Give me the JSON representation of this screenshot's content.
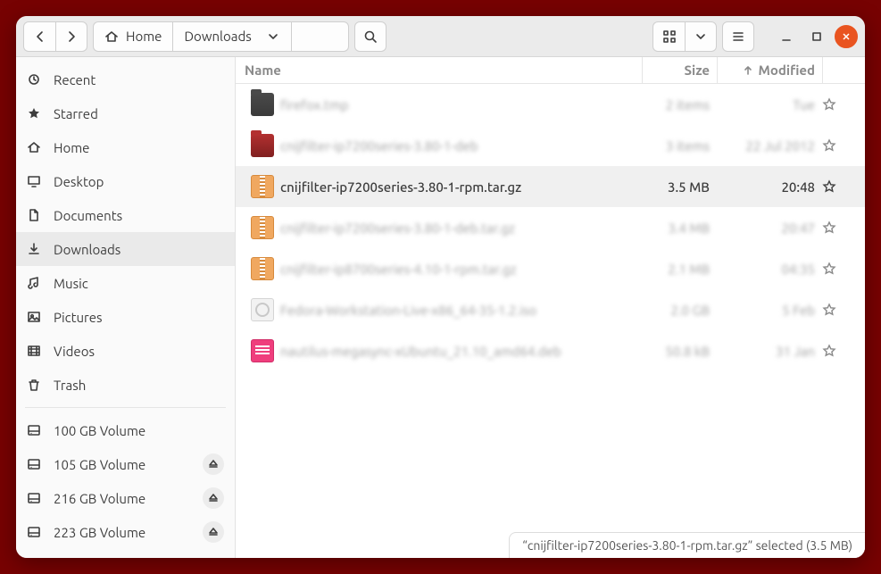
{
  "path": {
    "home_label": "Home",
    "folder_label": "Downloads"
  },
  "columns": {
    "name": "Name",
    "size": "Size",
    "modified": "Modified"
  },
  "sidebar": {
    "places": [
      {
        "icon": "recent",
        "label": "Recent"
      },
      {
        "icon": "starred",
        "label": "Starred"
      },
      {
        "icon": "home",
        "label": "Home"
      },
      {
        "icon": "desktop",
        "label": "Desktop"
      },
      {
        "icon": "documents",
        "label": "Documents"
      },
      {
        "icon": "downloads",
        "label": "Downloads",
        "active": true
      },
      {
        "icon": "music",
        "label": "Music"
      },
      {
        "icon": "pictures",
        "label": "Pictures"
      },
      {
        "icon": "videos",
        "label": "Videos"
      },
      {
        "icon": "trash",
        "label": "Trash"
      }
    ],
    "volumes": [
      {
        "label": "100 GB Volume",
        "eject": false
      },
      {
        "label": "105 GB Volume",
        "eject": true
      },
      {
        "label": "216 GB Volume",
        "eject": true
      },
      {
        "label": "223 GB Volume",
        "eject": true
      }
    ]
  },
  "files": [
    {
      "type": "folder-dark",
      "name": "firefox.tmp",
      "size": "2 items",
      "modified": "Tue"
    },
    {
      "type": "folder-red",
      "name": "cnijfilter-ip7200series-3.80-1-deb",
      "size": "3 items",
      "modified": "22 Jul 2012"
    },
    {
      "type": "archive",
      "name": "cnijfilter-ip7200series-3.80-1-rpm.tar.gz",
      "size": "3.5 MB",
      "modified": "20:48",
      "selected": true
    },
    {
      "type": "archive",
      "name": "cnijfilter-ip7200series-3.80-1-deb.tar.gz",
      "size": "3.4 MB",
      "modified": "20:47"
    },
    {
      "type": "archive",
      "name": "cnijfilter-ip8700series-4.10-1-rpm.tar.gz",
      "size": "2.1 MB",
      "modified": "04:35"
    },
    {
      "type": "iso",
      "name": "Fedora-Workstation-Live-x86_64-35-1.2.iso",
      "size": "2.0 GB",
      "modified": "5 Feb"
    },
    {
      "type": "deb",
      "name": "nautilus-megasync-xUbuntu_21.10_amd64.deb",
      "size": "50.8 kB",
      "modified": "31 Jan"
    }
  ],
  "status": "“cnijfilter-ip7200series-3.80-1-rpm.tar.gz” selected  (3.5 MB)"
}
